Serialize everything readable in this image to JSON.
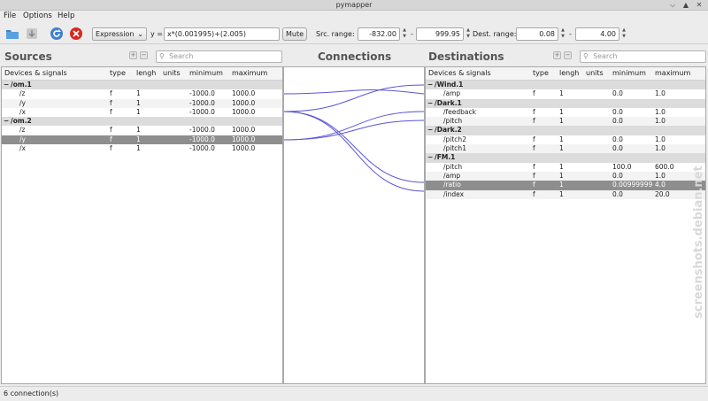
{
  "window": {
    "title": "pymapper",
    "min_icon": "minimize-glyph",
    "max_icon": "maximize-glyph",
    "close_icon": "close-glyph"
  },
  "menu": [
    "File",
    "Options",
    "Help"
  ],
  "toolbar": {
    "mode": "Expression",
    "y_label": "y =",
    "expression": "x*(0.001995)+(2.005)",
    "mute": "Mute",
    "src_label": "Src. range:",
    "src_min": "-832.00",
    "dash1": "-",
    "src_max": "999.95",
    "dest_label": "Dest. range:",
    "dest_min": "0.08",
    "dash2": "-",
    "dest_max": "4.00"
  },
  "sources": {
    "title": "Sources",
    "search_placeholder": "Search",
    "columns": [
      "Devices & signals",
      "type",
      "lengh",
      "units",
      "minimum",
      "maximum"
    ],
    "rows": [
      {
        "name": "/om.1",
        "group": true
      },
      {
        "name": "/z",
        "type": "f",
        "length": "1",
        "units": "",
        "min": "-1000.0",
        "max": "1000.0"
      },
      {
        "name": "/y",
        "type": "f",
        "length": "1",
        "units": "",
        "min": "-1000.0",
        "max": "1000.0"
      },
      {
        "name": "/x",
        "type": "f",
        "length": "1",
        "units": "",
        "min": "-1000.0",
        "max": "1000.0"
      },
      {
        "name": "/om.2",
        "group": true
      },
      {
        "name": "/z",
        "type": "f",
        "length": "1",
        "units": "",
        "min": "-1000.0",
        "max": "1000.0"
      },
      {
        "name": "/y",
        "type": "f",
        "length": "1",
        "units": "",
        "min": "-1000.0",
        "max": "1000.0",
        "selected": true
      },
      {
        "name": "/x",
        "type": "f",
        "length": "1",
        "units": "",
        "min": "-1000.0",
        "max": "1000.0"
      }
    ]
  },
  "connections": {
    "title": "Connections",
    "line_color": "#5a55d6"
  },
  "destinations": {
    "title": "Destinations",
    "search_placeholder": "Search",
    "columns": [
      "Devices & signals",
      "type",
      "lengh",
      "units",
      "minimum",
      "maximum"
    ],
    "rows": [
      {
        "name": "/Wind.1",
        "group": true
      },
      {
        "name": "/amp",
        "type": "f",
        "length": "1",
        "units": "",
        "min": "0.0",
        "max": "1.0"
      },
      {
        "name": "/Dark.1",
        "group": true
      },
      {
        "name": "/feedback",
        "type": "f",
        "length": "1",
        "units": "",
        "min": "0.0",
        "max": "1.0"
      },
      {
        "name": "/pitch",
        "type": "f",
        "length": "1",
        "units": "",
        "min": "0.0",
        "max": "1.0"
      },
      {
        "name": "/Dark.2",
        "group": true
      },
      {
        "name": "/pitch2",
        "type": "f",
        "length": "1",
        "units": "",
        "min": "0.0",
        "max": "1.0"
      },
      {
        "name": "/pitch1",
        "type": "f",
        "length": "1",
        "units": "",
        "min": "0.0",
        "max": "1.0"
      },
      {
        "name": "/FM.1",
        "group": true
      },
      {
        "name": "/pitch",
        "type": "f",
        "length": "1",
        "units": "",
        "min": "100.0",
        "max": "600.0"
      },
      {
        "name": "/amp",
        "type": "f",
        "length": "1",
        "units": "",
        "min": "0.0",
        "max": "1.0"
      },
      {
        "name": "/ratio",
        "type": "f",
        "length": "1",
        "units": "",
        "min": "0.00999999",
        "max": "4.0",
        "selected": true
      },
      {
        "name": "/index",
        "type": "f",
        "length": "1",
        "units": "",
        "min": "0.0",
        "max": "20.0"
      }
    ]
  },
  "status": "6 connection(s)",
  "watermark": "screenshots.debian.net",
  "colors": {
    "accent": "#5a55d6",
    "selection": "#8e8e8e",
    "group_row": "#dcdcdc"
  }
}
